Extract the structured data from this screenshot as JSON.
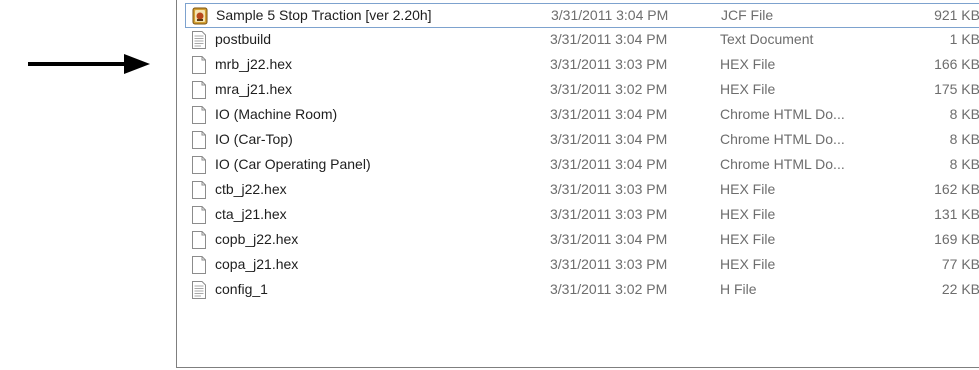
{
  "files": [
    {
      "name": "Sample 5 Stop Traction [ver 2.20h]",
      "date": "3/31/2011 3:04 PM",
      "type": "JCF File",
      "size": "921 KB",
      "icon": "jcf-file-icon"
    },
    {
      "name": "postbuild",
      "date": "3/31/2011 3:04 PM",
      "type": "Text Document",
      "size": "1 KB",
      "icon": "text-document-icon"
    },
    {
      "name": "mrb_j22.hex",
      "date": "3/31/2011 3:03 PM",
      "type": "HEX File",
      "size": "166 KB",
      "icon": "blank-file-icon"
    },
    {
      "name": "mra_j21.hex",
      "date": "3/31/2011 3:02 PM",
      "type": "HEX File",
      "size": "175 KB",
      "icon": "blank-file-icon"
    },
    {
      "name": "IO (Machine Room)",
      "date": "3/31/2011 3:04 PM",
      "type": "Chrome HTML Do...",
      "size": "8 KB",
      "icon": "blank-file-icon"
    },
    {
      "name": "IO (Car-Top)",
      "date": "3/31/2011 3:04 PM",
      "type": "Chrome HTML Do...",
      "size": "8 KB",
      "icon": "blank-file-icon"
    },
    {
      "name": "IO (Car Operating Panel)",
      "date": "3/31/2011 3:04 PM",
      "type": "Chrome HTML Do...",
      "size": "8 KB",
      "icon": "blank-file-icon"
    },
    {
      "name": "ctb_j22.hex",
      "date": "3/31/2011 3:03 PM",
      "type": "HEX File",
      "size": "162 KB",
      "icon": "blank-file-icon"
    },
    {
      "name": "cta_j21.hex",
      "date": "3/31/2011 3:03 PM",
      "type": "HEX File",
      "size": "131 KB",
      "icon": "blank-file-icon"
    },
    {
      "name": "copb_j22.hex",
      "date": "3/31/2011 3:04 PM",
      "type": "HEX File",
      "size": "169 KB",
      "icon": "blank-file-icon"
    },
    {
      "name": "copa_j21.hex",
      "date": "3/31/2011 3:03 PM",
      "type": "HEX File",
      "size": "77 KB",
      "icon": "blank-file-icon"
    },
    {
      "name": "config_1",
      "date": "3/31/2011 3:02 PM",
      "type": "H File",
      "size": "22 KB",
      "icon": "text-document-icon"
    }
  ],
  "colors": {
    "selection_border": "#7da2ce",
    "secondary_text": "#6d6d6d",
    "arrow": "#000000"
  }
}
